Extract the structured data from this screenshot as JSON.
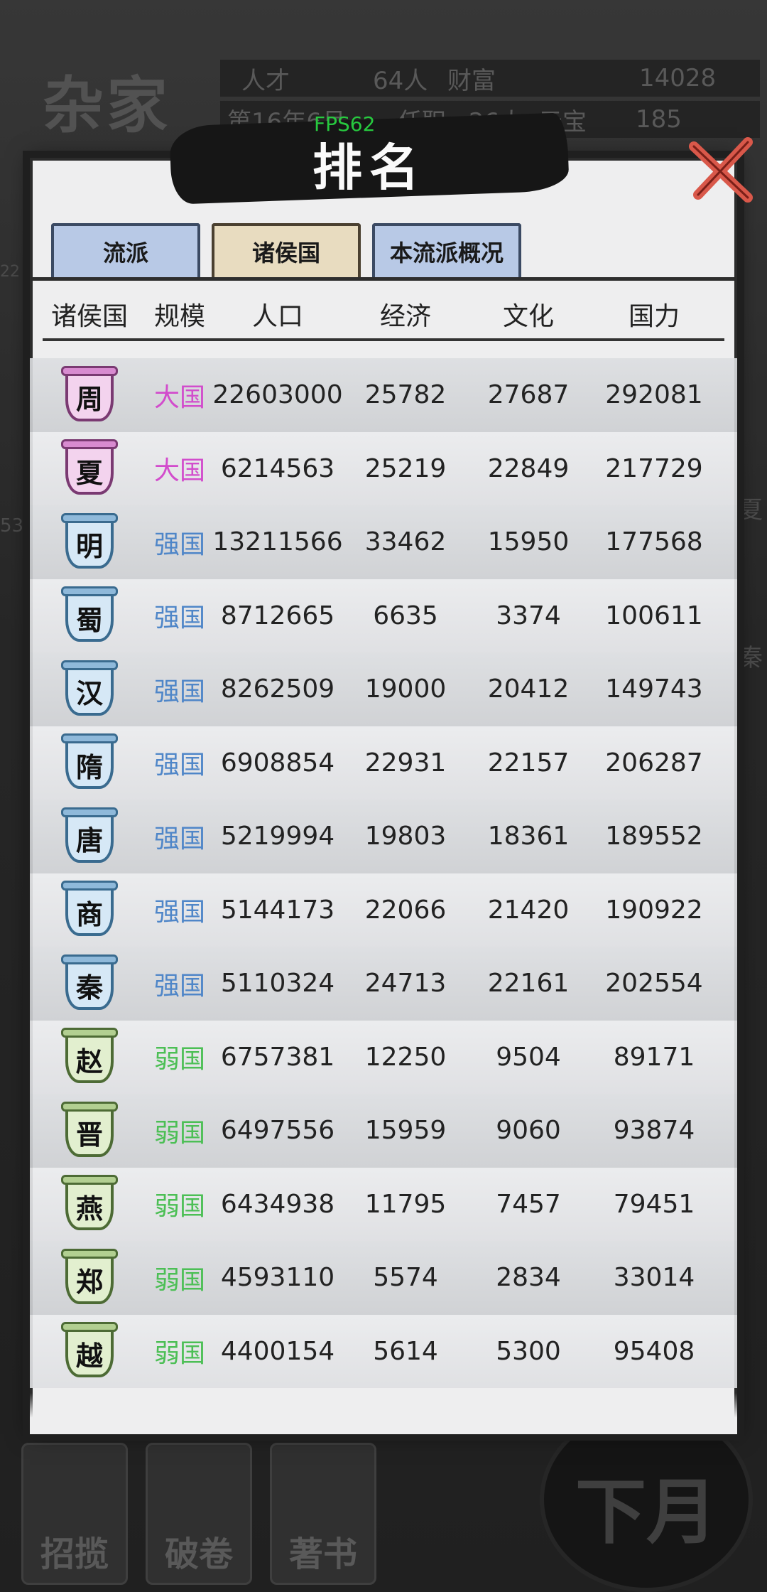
{
  "background": {
    "school_name": "杂家",
    "stats": {
      "talent_label": "人才",
      "talent_value": "64人",
      "wealth_label": "财富",
      "wealth_value": "14028",
      "date": "第16年6月",
      "office_label": "任职",
      "office_value": "26人",
      "ingot_label": "元宝",
      "ingot_value": "185"
    },
    "side_badges": [
      "22",
      "53",
      "夏",
      "秦"
    ],
    "bottom_buttons": [
      "招揽",
      "破卷",
      "著书"
    ],
    "next_month": "下月"
  },
  "fps": "FPS62",
  "title": "排名",
  "tabs": [
    {
      "label": "流派",
      "active": false
    },
    {
      "label": "诸侯国",
      "active": true
    },
    {
      "label": "本流派概况",
      "active": false
    }
  ],
  "columns": [
    "诸侯国",
    "规模",
    "人口",
    "经济",
    "文化",
    "国力"
  ],
  "rows": [
    {
      "state": "周",
      "scale": "大国",
      "tier": "big",
      "population": "22603000",
      "economy": "25782",
      "culture": "27687",
      "power": "292081"
    },
    {
      "state": "夏",
      "scale": "大国",
      "tier": "big",
      "population": "6214563",
      "economy": "25219",
      "culture": "22849",
      "power": "217729"
    },
    {
      "state": "明",
      "scale": "强国",
      "tier": "strong",
      "population": "13211566",
      "economy": "33462",
      "culture": "15950",
      "power": "177568"
    },
    {
      "state": "蜀",
      "scale": "强国",
      "tier": "strong",
      "population": "8712665",
      "economy": "6635",
      "culture": "3374",
      "power": "100611"
    },
    {
      "state": "汉",
      "scale": "强国",
      "tier": "strong",
      "population": "8262509",
      "economy": "19000",
      "culture": "20412",
      "power": "149743"
    },
    {
      "state": "隋",
      "scale": "强国",
      "tier": "strong",
      "population": "6908854",
      "economy": "22931",
      "culture": "22157",
      "power": "206287"
    },
    {
      "state": "唐",
      "scale": "强国",
      "tier": "strong",
      "population": "5219994",
      "economy": "19803",
      "culture": "18361",
      "power": "189552"
    },
    {
      "state": "商",
      "scale": "强国",
      "tier": "strong",
      "population": "5144173",
      "economy": "22066",
      "culture": "21420",
      "power": "190922"
    },
    {
      "state": "秦",
      "scale": "强国",
      "tier": "strong",
      "population": "5110324",
      "economy": "24713",
      "culture": "22161",
      "power": "202554"
    },
    {
      "state": "赵",
      "scale": "弱国",
      "tier": "weak",
      "population": "6757381",
      "economy": "12250",
      "culture": "9504",
      "power": "89171"
    },
    {
      "state": "晋",
      "scale": "弱国",
      "tier": "weak",
      "population": "6497556",
      "economy": "15959",
      "culture": "9060",
      "power": "93874"
    },
    {
      "state": "燕",
      "scale": "弱国",
      "tier": "weak",
      "population": "6434938",
      "economy": "11795",
      "culture": "7457",
      "power": "79451"
    },
    {
      "state": "郑",
      "scale": "弱国",
      "tier": "weak",
      "population": "4593110",
      "economy": "5574",
      "culture": "2834",
      "power": "33014"
    },
    {
      "state": "越",
      "scale": "弱国",
      "tier": "weak",
      "population": "4400154",
      "economy": "5614",
      "culture": "5300",
      "power": "95408"
    }
  ],
  "colors": {
    "big": "#d24ccc",
    "strong": "#4f86c8",
    "weak": "#4cbf55"
  }
}
